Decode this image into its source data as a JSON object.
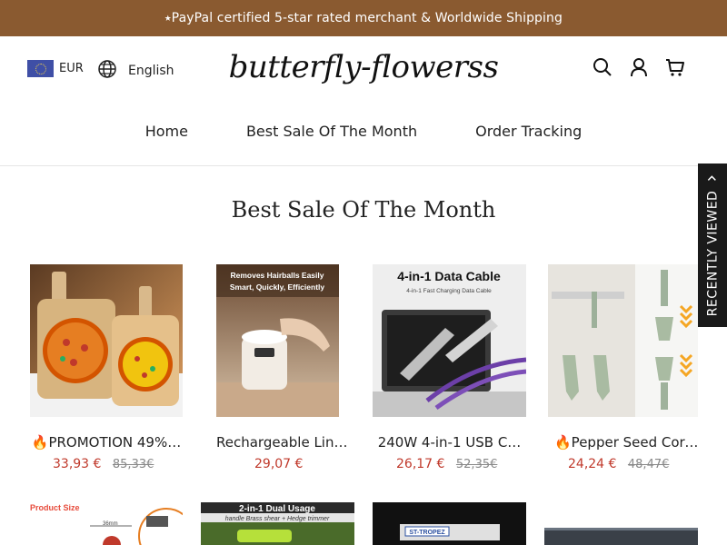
{
  "announcement": "⭑PayPal certified 5-star rated merchant & Worldwide Shipping",
  "header": {
    "currency": "EUR",
    "language": "English",
    "logo_text": "butterfly-flowerss"
  },
  "nav": {
    "items": [
      "Home",
      "Best Sale Of The Month",
      "Order Tracking"
    ]
  },
  "section_title": "Best Sale Of The Month",
  "products": [
    {
      "title": "🔥PROMOTION 49%…",
      "price": "33,93 €",
      "old_price": "85,33€"
    },
    {
      "title": "Rechargeable Lint…",
      "price": "29,07 €",
      "old_price": ""
    },
    {
      "title": "240W 4-in-1 USB C…",
      "price": "26,17 €",
      "old_price": "52,35€"
    },
    {
      "title": "🔥Pepper Seed Corer…",
      "price": "24,24 €",
      "old_price": "48,47€"
    }
  ],
  "product_images": {
    "lint_banner": "Removes Hairballs Easily Smart, Quickly, Efficiently",
    "cable_title": "4-in-1 Data Cable",
    "cable_sub": "4-in-1 Fast Charging Data Cable",
    "row2_a_label": "Product Size",
    "row2_a_size": "36mm",
    "row2_b_banner": "2-in-1 Dual Usage",
    "row2_b_sub": "handle Brass shear + Hedge trimmer",
    "row2_c_text": "ST-TROPEZ"
  },
  "recently_viewed": "RECENTLY VIEWED",
  "colors": {
    "announcement_bg": "#8a5a30",
    "sale_price": "#c0392b",
    "old_price": "#888888",
    "recent_bg": "#1a1a1a"
  }
}
